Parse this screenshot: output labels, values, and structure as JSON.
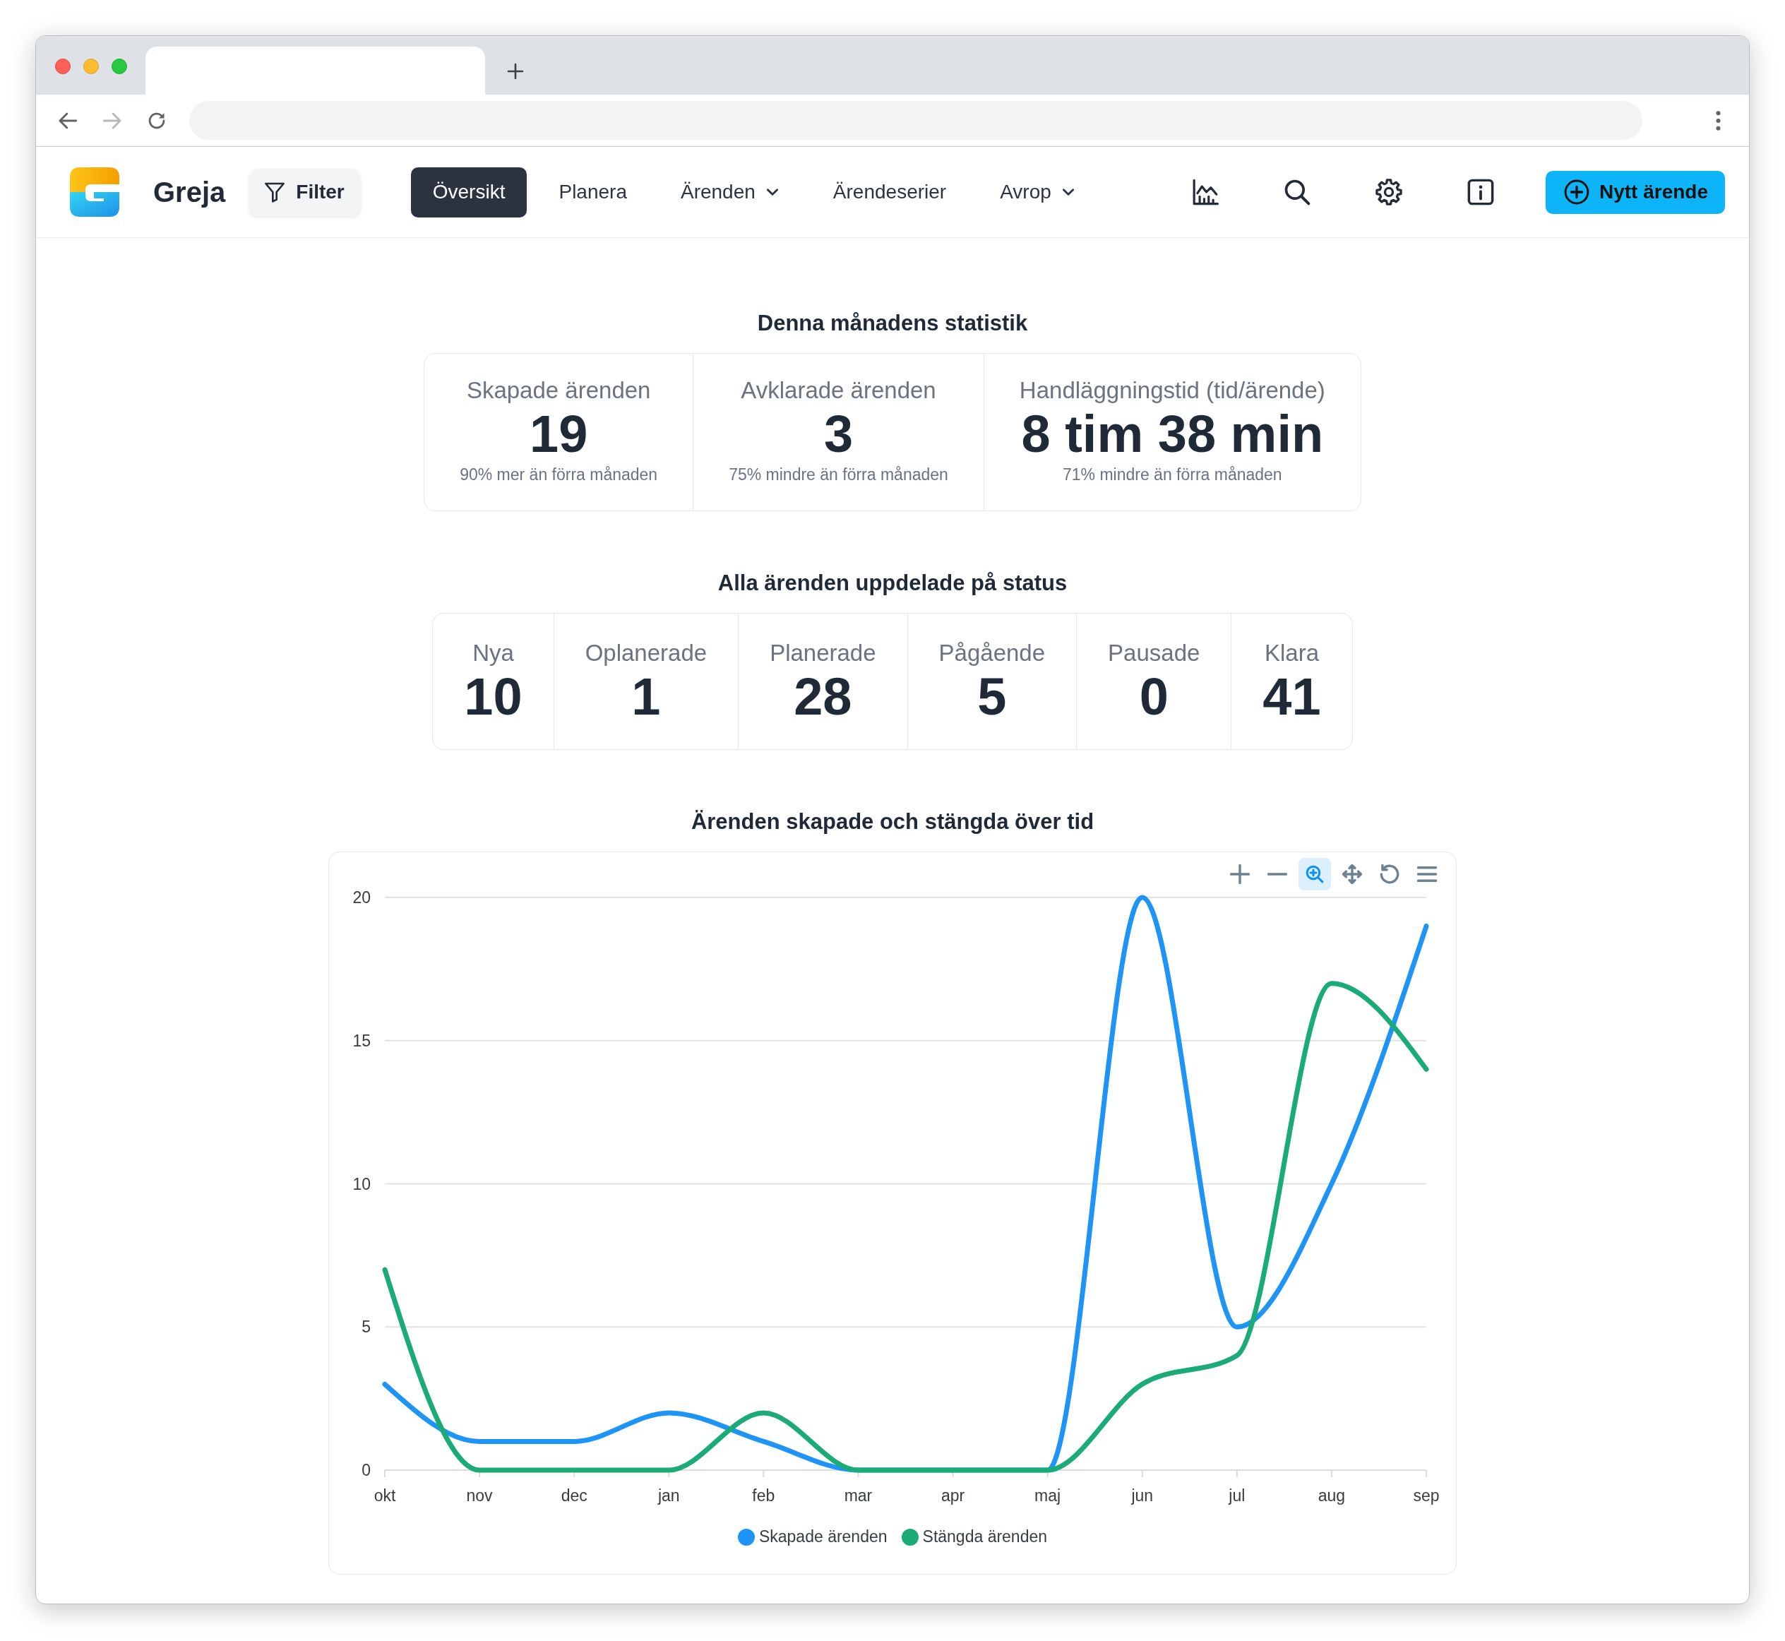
{
  "browser": {
    "nav_buttons": [
      {
        "kind": "back",
        "disabled": false
      },
      {
        "kind": "forward",
        "disabled": true
      },
      {
        "kind": "reload",
        "disabled": false
      }
    ]
  },
  "app": {
    "brand": "Greja",
    "filter_button": "Filter",
    "nav": [
      {
        "label": "Översikt",
        "selected": true,
        "dropdown": false
      },
      {
        "label": "Planera",
        "selected": false,
        "dropdown": false
      },
      {
        "label": "Ärenden",
        "selected": false,
        "dropdown": true
      },
      {
        "label": "Ärendeserier",
        "selected": false,
        "dropdown": false
      },
      {
        "label": "Avrop",
        "selected": false,
        "dropdown": true
      }
    ],
    "new_button": "Nytt ärende"
  },
  "monthly_stats": {
    "heading": "Denna månadens statistik",
    "items": [
      {
        "label": "Skapade ärenden",
        "value": "19",
        "change": "90% mer än förra månaden"
      },
      {
        "label": "Avklarade ärenden",
        "value": "3",
        "change": "75% mindre än förra månaden"
      },
      {
        "label": "Handläggningstid (tid/ärende)",
        "value": "8 tim 38 min",
        "change": "71% mindre än förra månaden"
      }
    ]
  },
  "status_counts": {
    "heading": "Alla ärenden uppdelade på status",
    "items": [
      {
        "label": "Nya",
        "value": "10"
      },
      {
        "label": "Oplanerade",
        "value": "1"
      },
      {
        "label": "Planerade",
        "value": "28"
      },
      {
        "label": "Pågående",
        "value": "5"
      },
      {
        "label": "Pausade",
        "value": "0"
      },
      {
        "label": "Klara",
        "value": "41"
      }
    ]
  },
  "chart_section": {
    "heading": "Ärenden skapade och stängda över tid",
    "toolbar": [
      {
        "kind": "plus",
        "selected": false
      },
      {
        "kind": "minus",
        "selected": false
      },
      {
        "kind": "zoom",
        "selected": true
      },
      {
        "kind": "pan",
        "selected": false
      },
      {
        "kind": "reset",
        "selected": false
      },
      {
        "kind": "menu",
        "selected": false
      }
    ],
    "chart_data": {
      "type": "line",
      "categories": [
        "okt",
        "nov",
        "dec",
        "jan",
        "feb",
        "mar",
        "apr",
        "maj",
        "jun",
        "jul",
        "aug",
        "sep"
      ],
      "series": [
        {
          "name": "Skapade ärenden",
          "color": "#1e94f6",
          "values": [
            3,
            1,
            1,
            2,
            1,
            0,
            0,
            0,
            20,
            5,
            10,
            19
          ]
        },
        {
          "name": "Stängda ärenden",
          "color": "#1aab76",
          "values": [
            7,
            0,
            0,
            0,
            2,
            0,
            0,
            0,
            3,
            4,
            17,
            14
          ]
        }
      ],
      "ylim": [
        0,
        20
      ],
      "yticks": [
        0,
        5,
        10,
        15,
        20
      ],
      "grid": true
    }
  }
}
